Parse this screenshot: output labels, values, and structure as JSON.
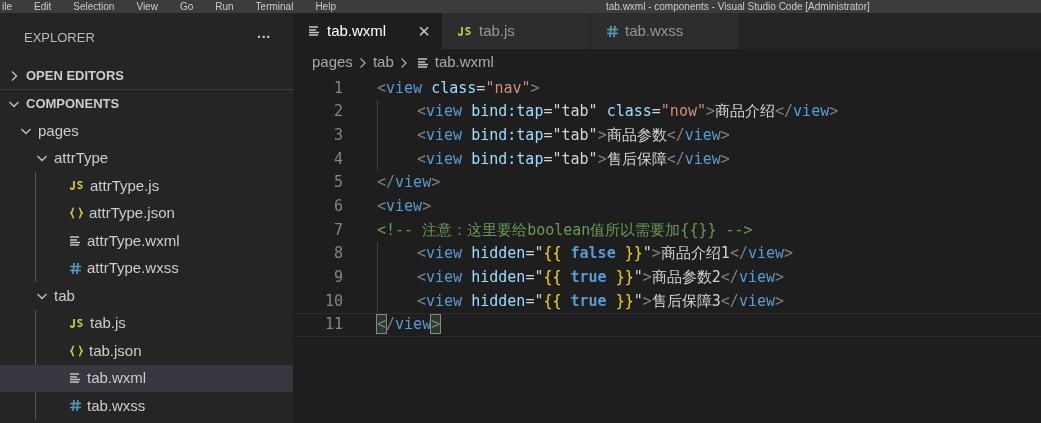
{
  "menu_bar": {
    "items": [
      "ile",
      "Edit",
      "Selection",
      "View",
      "Go",
      "Run",
      "Terminal",
      "Help"
    ],
    "title": "tab.wxml - components - Visual Studio Code [Administrator]"
  },
  "sidebar": {
    "title": "EXPLORER",
    "more": "···",
    "sections": [
      {
        "label": "OPEN EDITORS",
        "expanded": false
      },
      {
        "label": "COMPONENTS",
        "expanded": true,
        "children": [
          {
            "label": "pages",
            "kind": "folder",
            "expanded": true,
            "selected": false,
            "children": [
              {
                "label": "attrType",
                "kind": "folder",
                "expanded": true,
                "selected": false,
                "children": [
                  {
                    "label": "attrType.js",
                    "kind": "js",
                    "selected": false
                  },
                  {
                    "label": "attrType.json",
                    "kind": "json",
                    "selected": false
                  },
                  {
                    "label": "attrType.wxml",
                    "kind": "wxml",
                    "selected": false
                  },
                  {
                    "label": "attrType.wxss",
                    "kind": "wxss",
                    "selected": false
                  }
                ]
              },
              {
                "label": "tab",
                "kind": "folder",
                "expanded": true,
                "selected": false,
                "children": [
                  {
                    "label": "tab.js",
                    "kind": "js",
                    "selected": false
                  },
                  {
                    "label": "tab.json",
                    "kind": "json",
                    "selected": false
                  },
                  {
                    "label": "tab.wxml",
                    "kind": "wxml",
                    "selected": true
                  },
                  {
                    "label": "tab.wxss",
                    "kind": "wxss",
                    "selected": false
                  }
                ]
              }
            ]
          }
        ]
      }
    ]
  },
  "tabs": [
    {
      "label": "tab.wxml",
      "kind": "wxml",
      "selected": true,
      "close": "×"
    },
    {
      "label": "tab.js",
      "kind": "js",
      "selected": false
    },
    {
      "label": "tab.wxss",
      "kind": "wxss",
      "selected": false
    }
  ],
  "breadcrumb": {
    "parts": [
      "pages",
      "tab"
    ],
    "file": "tab.wxml",
    "kind": "wxml"
  },
  "editor": {
    "lines": [
      {
        "number": "1",
        "indent": false,
        "current": false,
        "tokens": [
          {
            "kind": "punct",
            "text": "<"
          },
          {
            "kind": "tag",
            "text": "view"
          },
          {
            "kind": "attr",
            "text": " class"
          },
          {
            "kind": "plain",
            "text": "="
          },
          {
            "kind": "string",
            "text": "\"nav\""
          },
          {
            "kind": "punct",
            "text": ">"
          }
        ]
      },
      {
        "number": "2",
        "indent": true,
        "current": false,
        "tokens": [
          {
            "kind": "punct",
            "text": "<"
          },
          {
            "kind": "tag",
            "text": "view"
          },
          {
            "kind": "attr",
            "text": " bind:tap"
          },
          {
            "kind": "plain",
            "text": "=\"tab\""
          },
          {
            "kind": "attr",
            "text": " class"
          },
          {
            "kind": "plain",
            "text": "="
          },
          {
            "kind": "string",
            "text": "\"now\""
          },
          {
            "kind": "punct",
            "text": ">"
          },
          {
            "kind": "plain",
            "text": "商品介绍"
          },
          {
            "kind": "punct",
            "text": "</"
          },
          {
            "kind": "tag",
            "text": "view"
          },
          {
            "kind": "punct",
            "text": ">"
          }
        ]
      },
      {
        "number": "3",
        "indent": true,
        "current": false,
        "tokens": [
          {
            "kind": "punct",
            "text": "<"
          },
          {
            "kind": "tag",
            "text": "view"
          },
          {
            "kind": "attr",
            "text": " bind:tap"
          },
          {
            "kind": "plain",
            "text": "=\"tab\""
          },
          {
            "kind": "punct",
            "text": ">"
          },
          {
            "kind": "plain",
            "text": "商品参数"
          },
          {
            "kind": "punct",
            "text": "</"
          },
          {
            "kind": "tag",
            "text": "view"
          },
          {
            "kind": "punct",
            "text": ">"
          }
        ]
      },
      {
        "number": "4",
        "indent": true,
        "current": false,
        "tokens": [
          {
            "kind": "punct",
            "text": "<"
          },
          {
            "kind": "tag",
            "text": "view"
          },
          {
            "kind": "attr",
            "text": " bind:tap"
          },
          {
            "kind": "plain",
            "text": "=\"tab\""
          },
          {
            "kind": "punct",
            "text": ">"
          },
          {
            "kind": "plain",
            "text": "售后保障"
          },
          {
            "kind": "punct",
            "text": "</"
          },
          {
            "kind": "tag",
            "text": "view"
          },
          {
            "kind": "punct",
            "text": ">"
          }
        ]
      },
      {
        "number": "5",
        "indent": false,
        "current": false,
        "tokens": [
          {
            "kind": "punct",
            "text": "</"
          },
          {
            "kind": "tag",
            "text": "view"
          },
          {
            "kind": "punct",
            "text": ">"
          }
        ]
      },
      {
        "number": "6",
        "indent": false,
        "current": false,
        "tokens": [
          {
            "kind": "punct",
            "text": "<"
          },
          {
            "kind": "tag",
            "text": "view"
          },
          {
            "kind": "punct",
            "text": ">"
          }
        ]
      },
      {
        "number": "7",
        "indent": false,
        "current": false,
        "tokens": [
          {
            "kind": "comment",
            "text": "<!-- 注意：这里要给boolean值所以需要加{{}} -->"
          }
        ]
      },
      {
        "number": "8",
        "indent": true,
        "current": false,
        "tokens": [
          {
            "kind": "punct",
            "text": "<"
          },
          {
            "kind": "tag",
            "text": "view"
          },
          {
            "kind": "attr",
            "text": " hidden"
          },
          {
            "kind": "plain",
            "text": "=\""
          },
          {
            "kind": "brace",
            "text": "{{"
          },
          {
            "kind": "keyword",
            "text": " false "
          },
          {
            "kind": "brace",
            "text": "}}"
          },
          {
            "kind": "plain",
            "text": "\""
          },
          {
            "kind": "punct",
            "text": ">"
          },
          {
            "kind": "plain",
            "text": "商品介绍1"
          },
          {
            "kind": "punct",
            "text": "</"
          },
          {
            "kind": "tag",
            "text": "view"
          },
          {
            "kind": "punct",
            "text": ">"
          }
        ]
      },
      {
        "number": "9",
        "indent": true,
        "current": false,
        "tokens": [
          {
            "kind": "punct",
            "text": "<"
          },
          {
            "kind": "tag",
            "text": "view"
          },
          {
            "kind": "attr",
            "text": " hidden"
          },
          {
            "kind": "plain",
            "text": "=\""
          },
          {
            "kind": "brace",
            "text": "{{"
          },
          {
            "kind": "keyword",
            "text": " true "
          },
          {
            "kind": "brace",
            "text": "}}"
          },
          {
            "kind": "plain",
            "text": "\""
          },
          {
            "kind": "punct",
            "text": ">"
          },
          {
            "kind": "plain",
            "text": "商品参数2"
          },
          {
            "kind": "punct",
            "text": "</"
          },
          {
            "kind": "tag",
            "text": "view"
          },
          {
            "kind": "punct",
            "text": ">"
          }
        ]
      },
      {
        "number": "10",
        "indent": true,
        "current": false,
        "tokens": [
          {
            "kind": "punct",
            "text": "<"
          },
          {
            "kind": "tag",
            "text": "view"
          },
          {
            "kind": "attr",
            "text": " hidden"
          },
          {
            "kind": "plain",
            "text": "=\""
          },
          {
            "kind": "brace",
            "text": "{{"
          },
          {
            "kind": "keyword",
            "text": " true "
          },
          {
            "kind": "brace",
            "text": "}}"
          },
          {
            "kind": "plain",
            "text": "\""
          },
          {
            "kind": "punct",
            "text": ">"
          },
          {
            "kind": "plain",
            "text": "售后保障3"
          },
          {
            "kind": "punct",
            "text": "</"
          },
          {
            "kind": "tag",
            "text": "view"
          },
          {
            "kind": "punct",
            "text": ">"
          }
        ]
      },
      {
        "number": "11",
        "indent": false,
        "current": true,
        "tokens": [
          {
            "kind": "match",
            "text": "<"
          },
          {
            "kind": "punct",
            "text": "/"
          },
          {
            "kind": "tag",
            "text": "view"
          },
          {
            "kind": "match",
            "text": ">"
          }
        ]
      }
    ]
  }
}
